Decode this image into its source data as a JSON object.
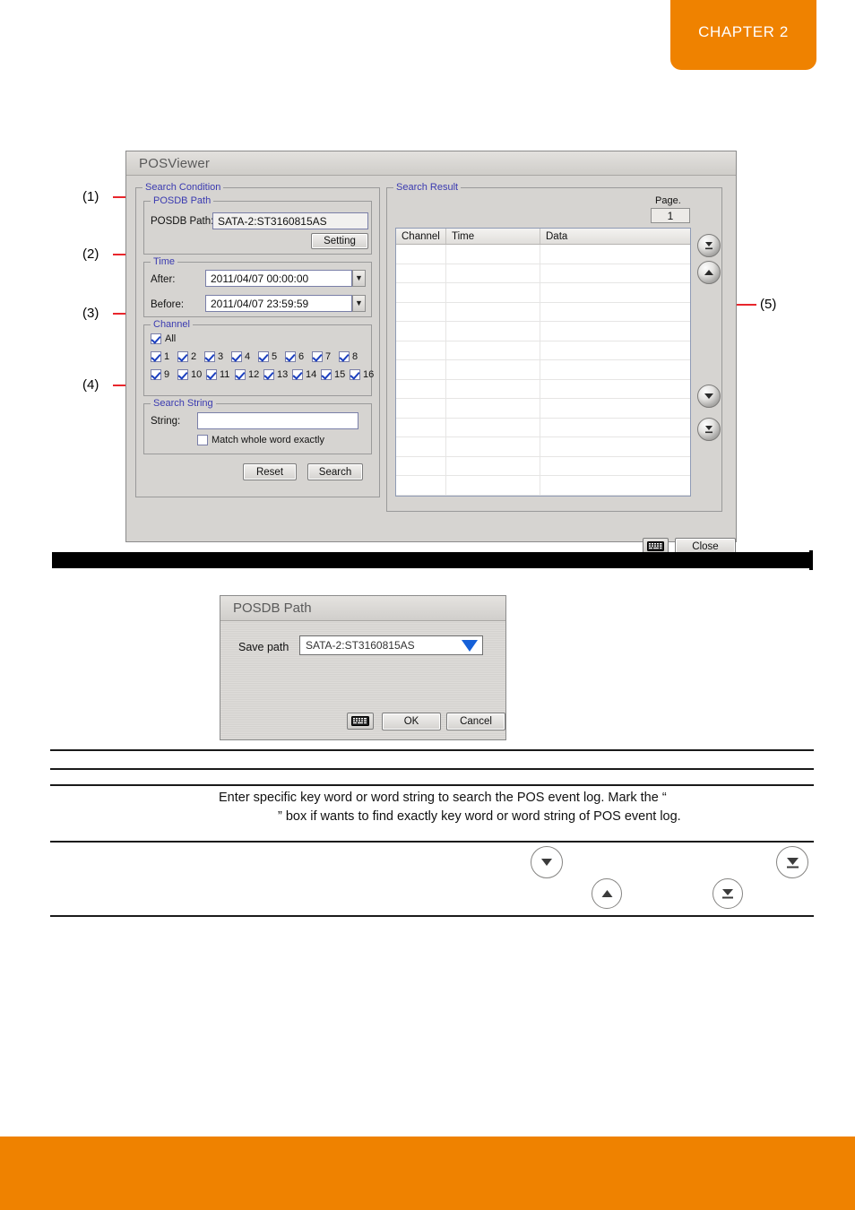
{
  "chapter": {
    "label": "CHAPTER 2"
  },
  "callouts": [
    {
      "label": "(1)"
    },
    {
      "label": "(2)"
    },
    {
      "label": "(3)"
    },
    {
      "label": "(4)"
    },
    {
      "label": "(5)"
    }
  ],
  "posviewer": {
    "title": "POSViewer",
    "search_condition": {
      "legend": "Search Condition",
      "posdb_path": {
        "legend": "POSDB Path",
        "field_label": "POSDB Path:",
        "field_value": "SATA-2:ST3160815AS",
        "setting_button": "Setting"
      },
      "time": {
        "legend": "Time",
        "after_label": "After:",
        "after_value": "2011/04/07  00:00:00",
        "before_label": "Before:",
        "before_value": "2011/04/07  23:59:59",
        "dropdown_icon": "chevron-down-icon"
      },
      "channel": {
        "legend": "Channel",
        "all_label": "All",
        "all_checked": true,
        "channels": [
          {
            "label": "1",
            "checked": true
          },
          {
            "label": "2",
            "checked": true
          },
          {
            "label": "3",
            "checked": true
          },
          {
            "label": "4",
            "checked": true
          },
          {
            "label": "5",
            "checked": true
          },
          {
            "label": "6",
            "checked": true
          },
          {
            "label": "7",
            "checked": true
          },
          {
            "label": "8",
            "checked": true
          },
          {
            "label": "9",
            "checked": true
          },
          {
            "label": "10",
            "checked": true
          },
          {
            "label": "11",
            "checked": true
          },
          {
            "label": "12",
            "checked": true
          },
          {
            "label": "13",
            "checked": true
          },
          {
            "label": "14",
            "checked": true
          },
          {
            "label": "15",
            "checked": true
          },
          {
            "label": "16",
            "checked": true
          }
        ]
      },
      "search_string": {
        "legend": "Search String",
        "string_label": "String:",
        "string_value": "",
        "match_label": "Match whole word exactly",
        "match_checked": false
      },
      "reset_button": "Reset",
      "search_button": "Search"
    },
    "search_result": {
      "legend": "Search Result",
      "page_label": "Page.",
      "page_value": "1",
      "columns": [
        "Channel",
        "Time",
        "Data"
      ],
      "rows": [],
      "row_count": 13,
      "nav_buttons": [
        {
          "name": "first-page-icon"
        },
        {
          "name": "prev-page-icon"
        },
        {
          "name": "next-page-icon"
        },
        {
          "name": "last-page-icon"
        }
      ]
    },
    "footer": {
      "keyboard_icon": "keyboard-icon",
      "close_button": "Close"
    }
  },
  "posdb_dialog": {
    "title": "POSDB Path",
    "save_path_label": "Save path",
    "save_path_value": "SATA-2:ST3160815AS",
    "dropdown_icon": "chevron-down-icon",
    "keyboard_icon": "keyboard-icon",
    "ok_button": "OK",
    "cancel_button": "Cancel"
  },
  "description": {
    "line1": "Enter specific key word or word string to search the POS event log. Mark the “",
    "line2": "” box if wants to find exactly key word or word string of POS event log."
  },
  "doc_nav_icons": [
    {
      "name": "next-page-icon"
    },
    {
      "name": "prev-page-icon"
    },
    {
      "name": "first-page-icon"
    },
    {
      "name": "last-page-icon"
    }
  ],
  "colors": {
    "accent_orange": "#ef8200",
    "legend_blue": "#3a3ab0",
    "callout_red": "#e8262c"
  }
}
